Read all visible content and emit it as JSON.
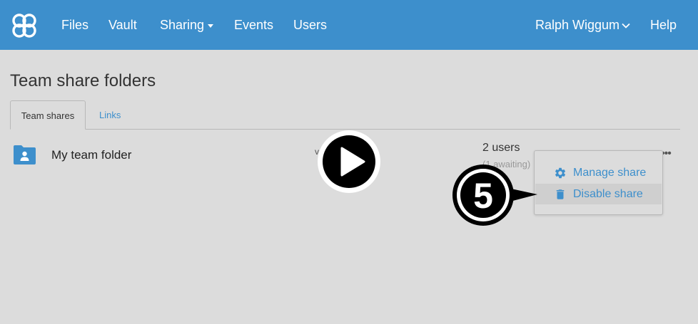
{
  "nav": {
    "links": {
      "files": "Files",
      "vault": "Vault",
      "sharing": "Sharing",
      "events": "Events",
      "users": "Users"
    },
    "user_name": "Ralph Wiggum",
    "help": "Help",
    "brand_color": "#3d8fcc"
  },
  "page": {
    "title": "Team share folders",
    "tabs": {
      "team_shares": "Team shares",
      "links": "Links"
    },
    "active_tab": "Team shares"
  },
  "share_row": {
    "folder_name": "My team folder",
    "stray_char": "v",
    "users_count": "2 users",
    "status": "(1 awaiting)",
    "more_icon": "more-dots-icon"
  },
  "menu": {
    "manage": "Manage share",
    "disable": "Disable share",
    "manage_icon": "gear-icon",
    "disable_icon": "trash-icon"
  },
  "overlay": {
    "step": "5",
    "play_icon": "play-icon"
  }
}
